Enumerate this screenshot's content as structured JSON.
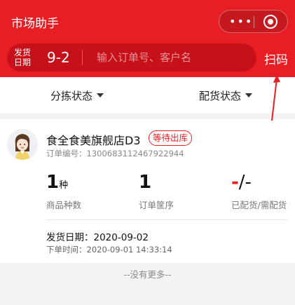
{
  "header": {
    "title": "市场助手",
    "capsule_more_icon": "more-dots-icon",
    "capsule_close_icon": "target-circle-icon"
  },
  "search": {
    "ship_label": "发货日期",
    "ship_date": "9-2",
    "placeholder": "输入订单号、客户名",
    "scan_label": "扫码"
  },
  "filters": {
    "sort_status": "分拣状态",
    "dispatch_status": "配货状态"
  },
  "order": {
    "store_name": "食全食美旗舰店D3",
    "status_badge": "等待出库",
    "order_no_label": "订单编号：",
    "order_no": "1300683112467922944",
    "stats": [
      {
        "value": "1",
        "unit": "种",
        "label": "商品种数"
      },
      {
        "value": "1",
        "unit": "",
        "label": "订单筐序"
      },
      {
        "value_red": "-",
        "value_rest": "/-",
        "label": "已配货/需配货"
      }
    ],
    "ship_date_label": "发货日期：",
    "ship_date": "2020-09-02",
    "order_time_label": "下单时间：",
    "order_time": "2020-09-01 14:33:14"
  },
  "footer": {
    "no_more": "--没有更多--"
  },
  "colors": {
    "brand_red": "#e81e25",
    "search_bg": "#c7111a"
  }
}
